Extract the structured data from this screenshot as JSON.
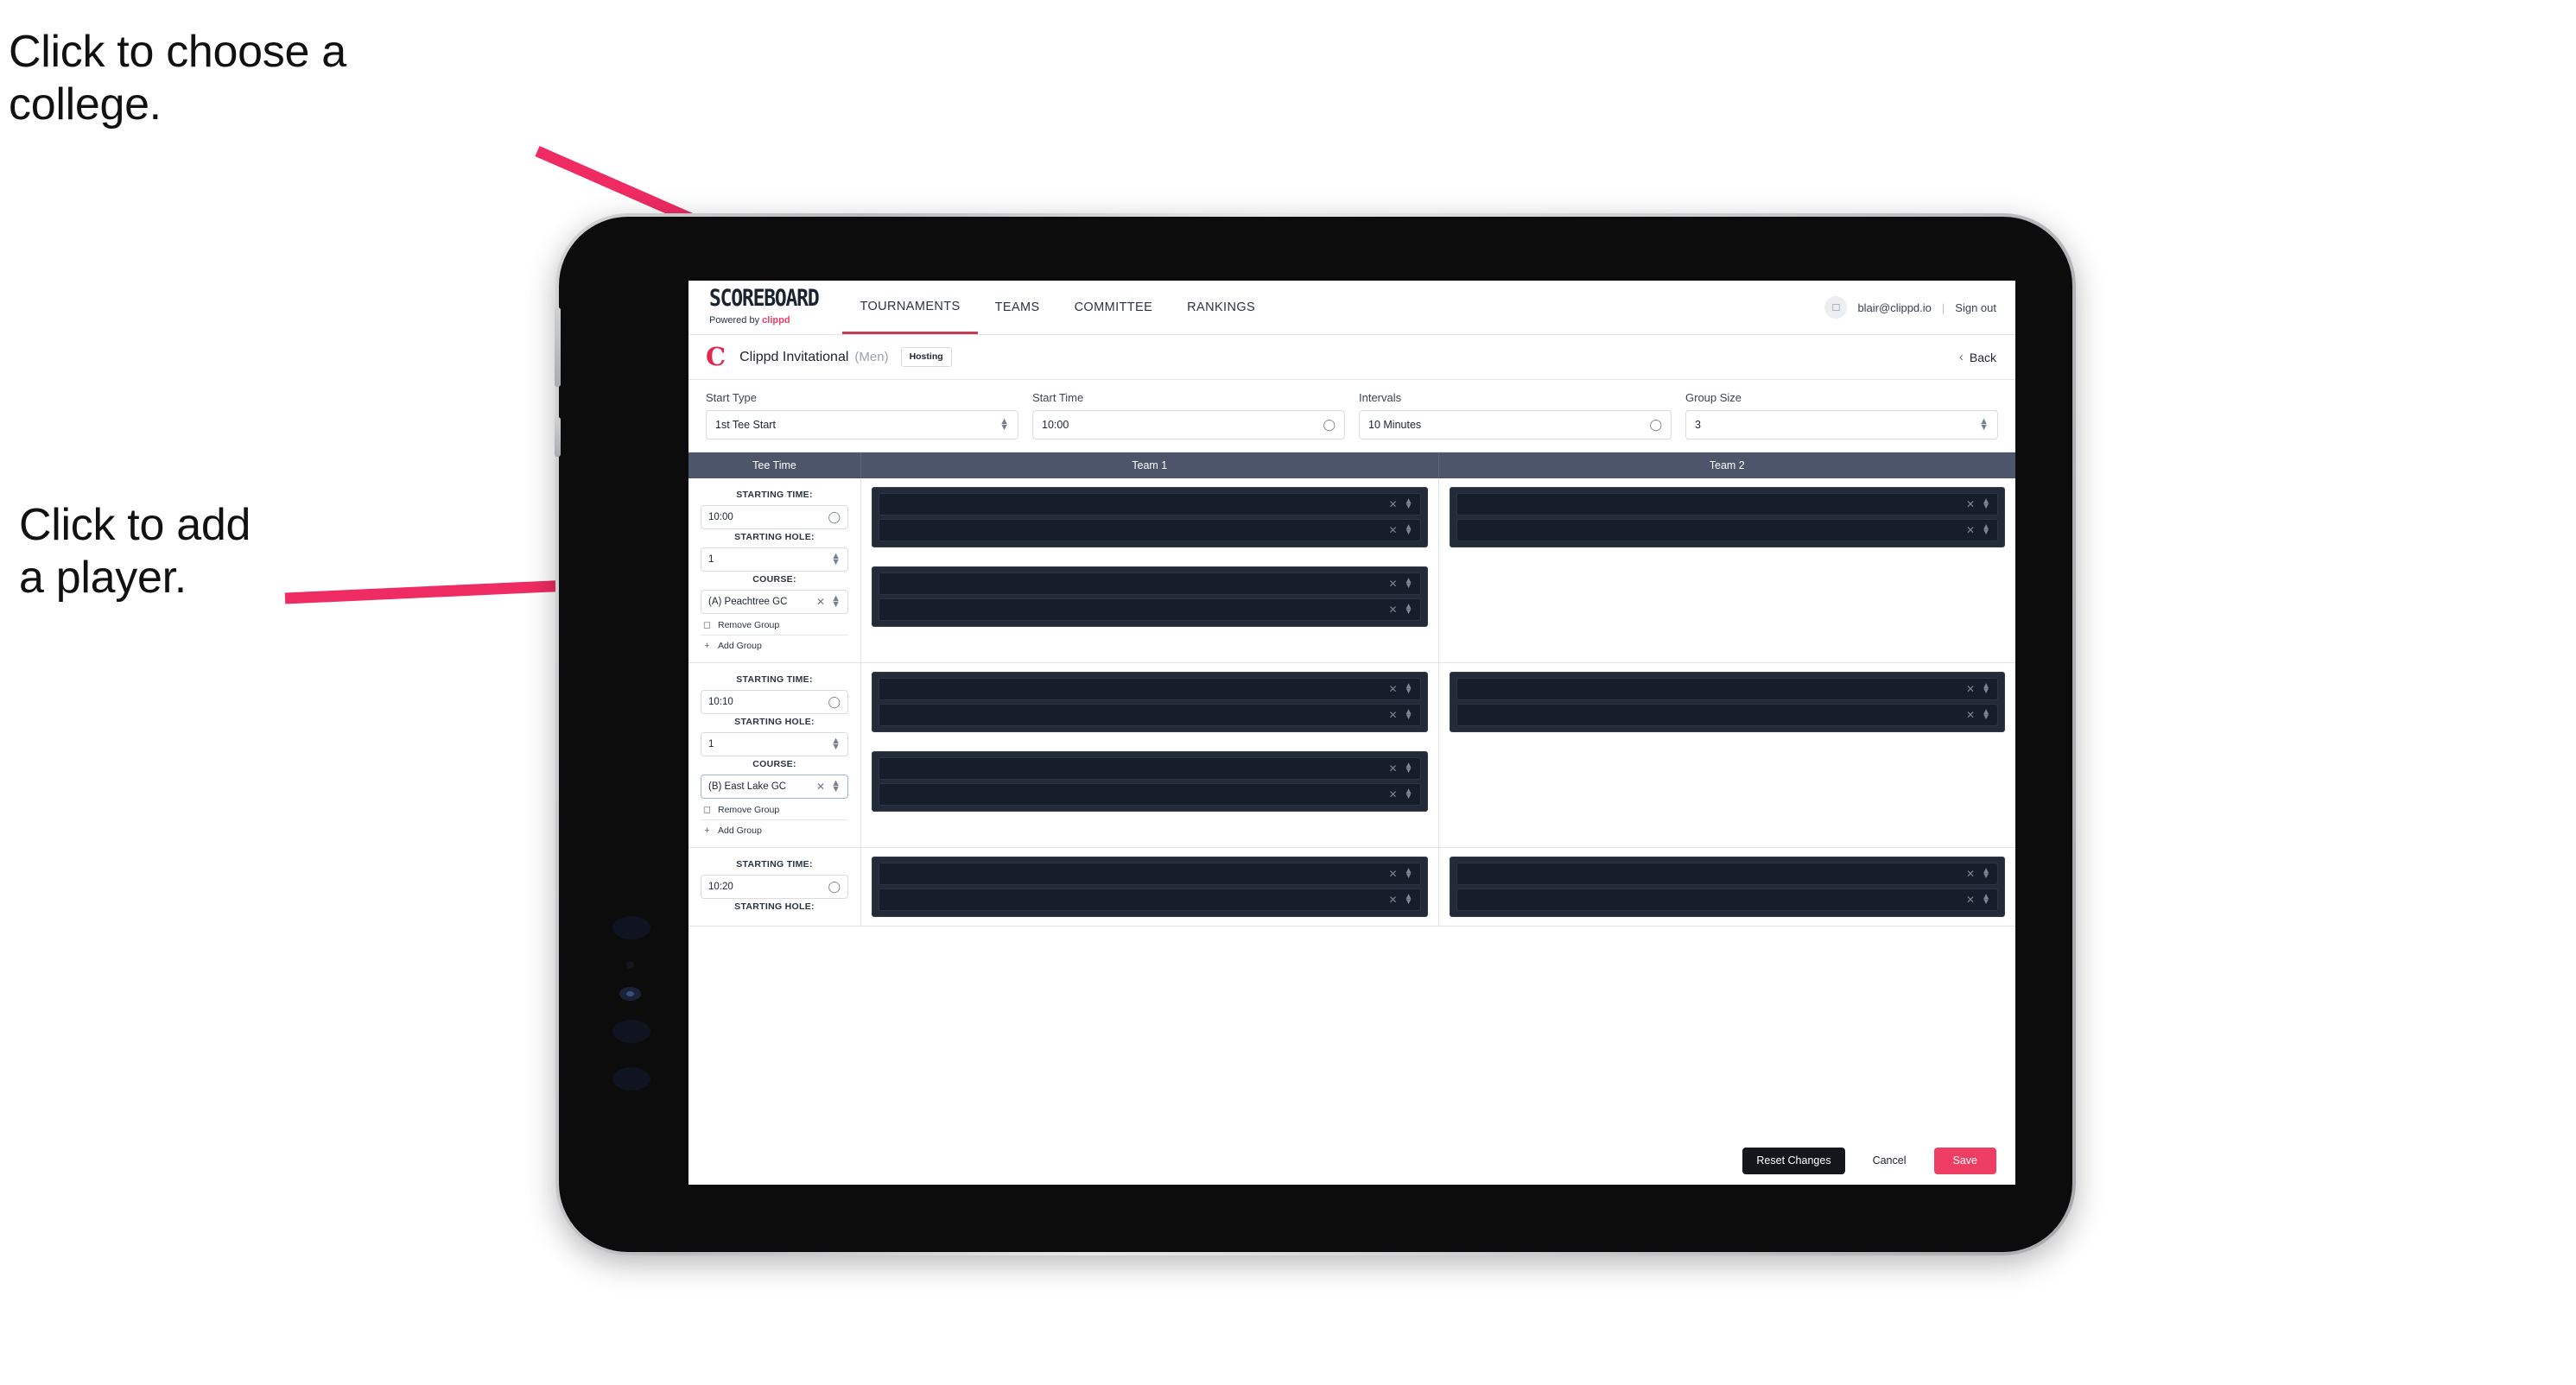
{
  "annotations": {
    "college": "Click to choose a\ncollege.",
    "player": "Click to add\na player.",
    "arrow_color": "#EE2B62"
  },
  "topnav": {
    "brand_name": "SCOREBOARD",
    "brand_sub_prefix": "Powered by ",
    "brand_sub_accent": "clippd",
    "links": [
      {
        "label": "TOURNAMENTS",
        "active": true
      },
      {
        "label": "TEAMS",
        "active": false
      },
      {
        "label": "COMMITTEE",
        "active": false
      },
      {
        "label": "RANKINGS",
        "active": false
      }
    ],
    "avatar_icon": "user-avatar-icon",
    "user_email": "blair@clippd.io",
    "separator": "|",
    "signout_label": "Sign out"
  },
  "tournament_bar": {
    "logo_letter": "C",
    "name": "Clippd Invitational",
    "gender": "(Men)",
    "badge": "Hosting",
    "back_label": "Back",
    "back_chevron": "‹"
  },
  "form": {
    "fields": [
      {
        "label": "Start Type",
        "value": "1st Tee Start",
        "icon": "stepper-icon"
      },
      {
        "label": "Start Time",
        "value": "10:00",
        "icon": "clock-icon"
      },
      {
        "label": "Intervals",
        "value": "10 Minutes",
        "icon": "clock-icon"
      },
      {
        "label": "Group Size",
        "value": "3",
        "icon": "stepper-icon"
      }
    ]
  },
  "table": {
    "headers": {
      "tee_time": "Tee Time",
      "team1": "Team 1",
      "team2": "Team 2"
    },
    "labels": {
      "starting_time": "STARTING TIME:",
      "starting_hole": "STARTING HOLE:",
      "course": "COURSE:",
      "remove_group": "Remove Group",
      "add_group": "Add Group",
      "trash_icon": "trash-icon",
      "plus_icon": "plus-icon",
      "clock_icon": "clock-icon",
      "stepper_icon": "stepper-icon",
      "clear_icon": "clear-x-icon"
    },
    "rows": [
      {
        "starting_time": "10:00",
        "starting_hole": "1",
        "course": "(A) Peachtree GC",
        "course_focused": false,
        "team1_groups": [
          2,
          2
        ],
        "team2_groups": [
          2
        ]
      },
      {
        "starting_time": "10:10",
        "starting_hole": "1",
        "course": "(B) East Lake GC",
        "course_focused": true,
        "team1_groups": [
          2,
          2
        ],
        "team2_groups": [
          2
        ]
      },
      {
        "starting_time": "10:20",
        "starting_hole": "",
        "course": "",
        "course_focused": false,
        "team1_groups": [
          2
        ],
        "team2_groups": [
          2
        ]
      }
    ]
  },
  "footer": {
    "reset_label": "Reset Changes",
    "cancel_label": "Cancel",
    "save_label": "Save",
    "save_color": "#EF3E63"
  }
}
